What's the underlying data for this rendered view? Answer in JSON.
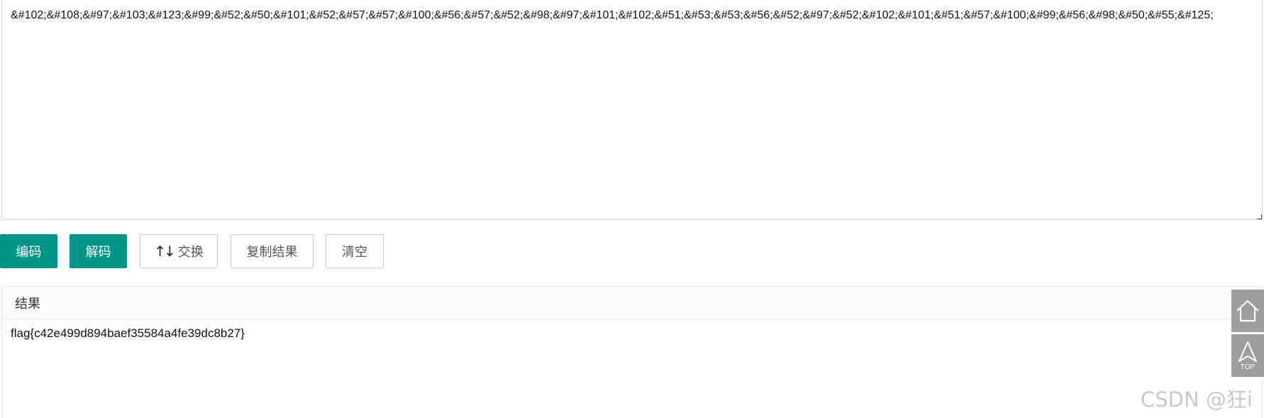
{
  "input": {
    "value": "&#102;&#108;&#97;&#103;&#123;&#99;&#52;&#50;&#101;&#52;&#57;&#57;&#100;&#56;&#57;&#52;&#98;&#97;&#101;&#102;&#51;&#53;&#53;&#56;&#52;&#97;&#52;&#102;&#101;&#51;&#57;&#100;&#99;&#56;&#98;&#50;&#55;&#125;"
  },
  "toolbar": {
    "encode_label": "编码",
    "decode_label": "解码",
    "swap_label": "交换",
    "copy_label": "复制结果",
    "clear_label": "清空"
  },
  "result": {
    "title": "结果",
    "value": "flag{c42e499d894baef35584a4fe39dc8b27}"
  },
  "side_tools": {
    "top_label": "TOP"
  },
  "watermark": "CSDN @狂i",
  "colors": {
    "primary": "#009688",
    "side_button": "#9e9e9e"
  },
  "icons": [
    "swap-arrows-icon",
    "home-icon",
    "back-to-top-icon"
  ]
}
